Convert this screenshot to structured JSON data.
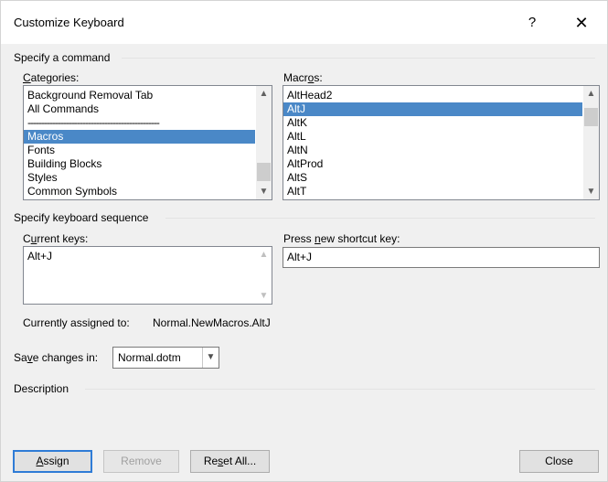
{
  "dialog": {
    "title": "Customize Keyboard",
    "help_glyph": "?",
    "close_glyph": "✕"
  },
  "specify_command": {
    "group_label": "Specify a command",
    "categories": {
      "label_u": "C",
      "label_rest": "ategories:",
      "items": [
        "Background Removal Tab",
        "All Commands",
        "------------------------------------------------",
        "Macros",
        "Fonts",
        "Building Blocks",
        "Styles",
        "Common Symbols"
      ],
      "selected_index": 3
    },
    "macros": {
      "label_pre": "Macr",
      "label_u": "o",
      "label_post": "s:",
      "items": [
        "AltHead2",
        "AltJ",
        "AltK",
        "AltL",
        "AltN",
        "AltProd",
        "AltS",
        "AltT"
      ],
      "selected_index": 1
    }
  },
  "keyboard_sequence": {
    "group_label": "Specify keyboard sequence",
    "current_keys": {
      "label_pre": "C",
      "label_u": "u",
      "label_post": "rrent keys:",
      "items": [
        "Alt+J"
      ]
    },
    "new_shortcut": {
      "label_pre": "Press ",
      "label_u": "n",
      "label_post": "ew shortcut key:",
      "value": "Alt+J"
    },
    "assigned_label": "Currently assigned to:",
    "assigned_value": "Normal.NewMacros.AltJ"
  },
  "save_changes": {
    "label_pre": "Sa",
    "label_u": "v",
    "label_post": "e changes in:",
    "value": "Normal.dotm"
  },
  "description": {
    "group_label": "Description"
  },
  "buttons": {
    "assign_u": "A",
    "assign_rest": "ssign",
    "remove": "Remove",
    "reset_pre": "Re",
    "reset_u": "s",
    "reset_post": "et All...",
    "close": "Close"
  },
  "icons": {
    "scroll_up": "▲",
    "scroll_down": "▼",
    "dropdown": "▼"
  }
}
